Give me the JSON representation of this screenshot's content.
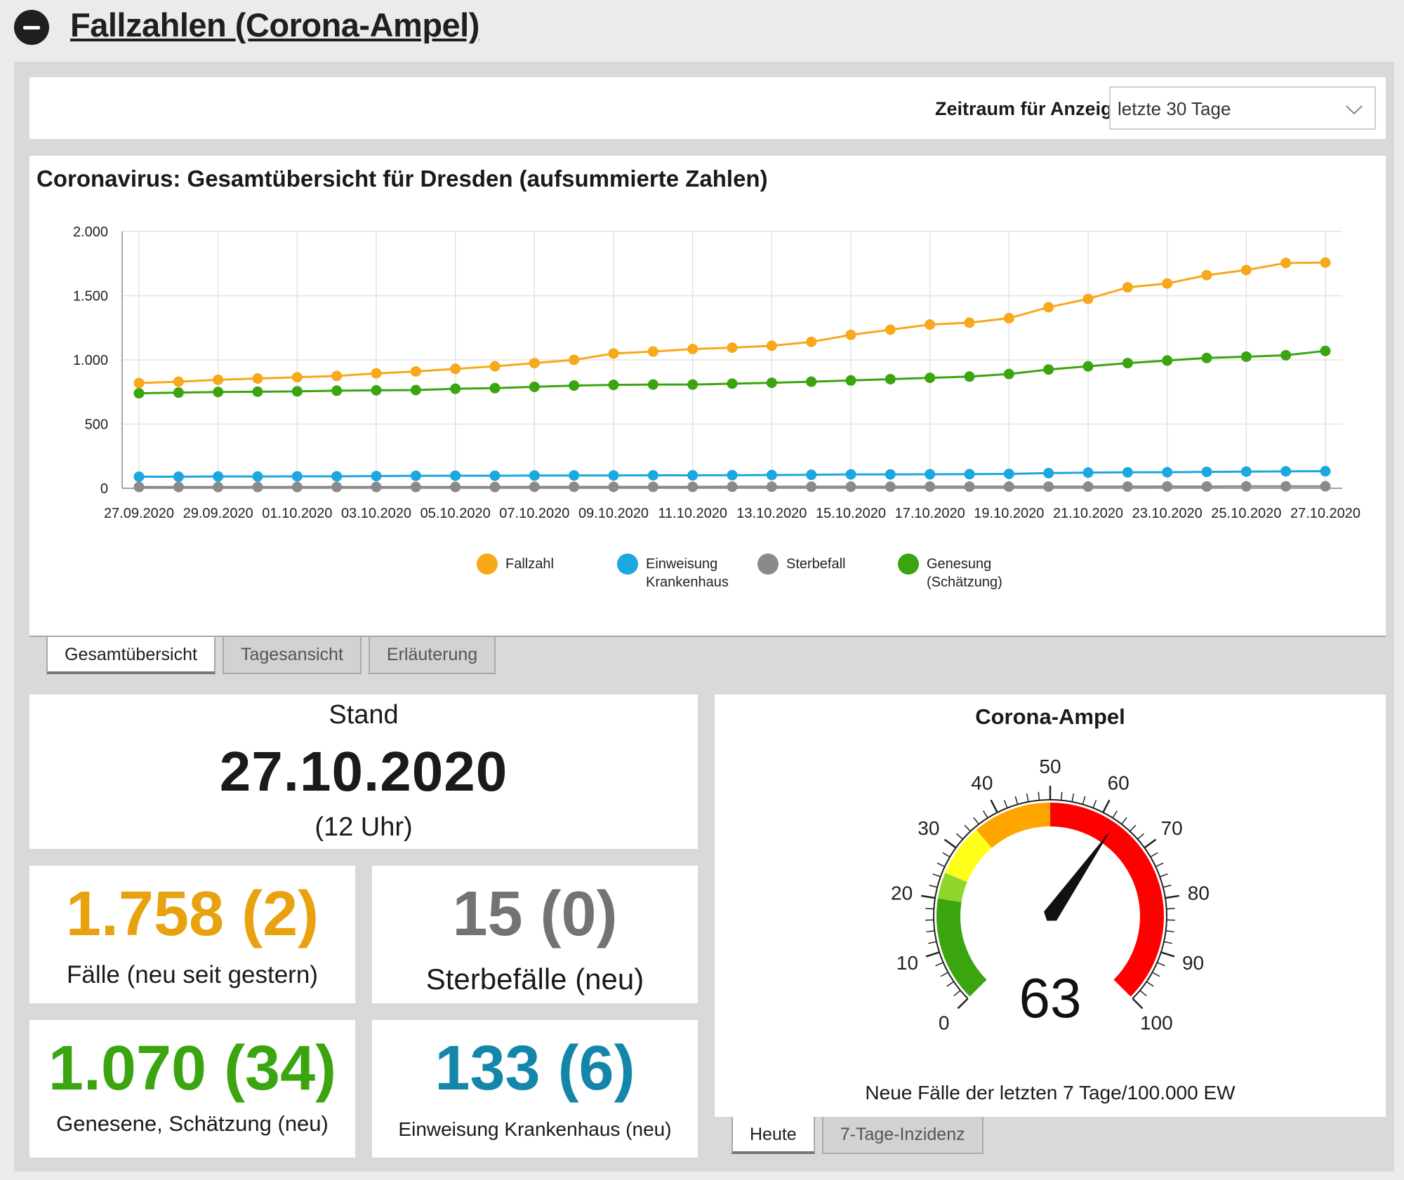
{
  "header": {
    "title": "Fallzahlen (Corona-Ampel)"
  },
  "filter": {
    "label": "Zeitraum für Anzeige:",
    "selected": "letzte 30 Tage"
  },
  "chart": {
    "title": "Coronavirus: Gesamtübersicht für Dresden (aufsummierte Zahlen)"
  },
  "chart_data": {
    "type": "line",
    "title": "Coronavirus: Gesamtübersicht für Dresden (aufsummierte Zahlen)",
    "xlabel": "",
    "ylabel": "",
    "ylim": [
      0,
      2000
    ],
    "yticks": [
      0,
      500,
      1000,
      1500,
      2000
    ],
    "ytick_labels": [
      "0",
      "500",
      "1.000",
      "1.500",
      "2.000"
    ],
    "x": [
      "27.09.2020",
      "28.09.2020",
      "29.09.2020",
      "30.09.2020",
      "01.10.2020",
      "02.10.2020",
      "03.10.2020",
      "04.10.2020",
      "05.10.2020",
      "06.10.2020",
      "07.10.2020",
      "08.10.2020",
      "09.10.2020",
      "10.10.2020",
      "11.10.2020",
      "12.10.2020",
      "13.10.2020",
      "14.10.2020",
      "15.10.2020",
      "16.10.2020",
      "17.10.2020",
      "18.10.2020",
      "19.10.2020",
      "20.10.2020",
      "21.10.2020",
      "22.10.2020",
      "23.10.2020",
      "24.10.2020",
      "25.10.2020",
      "26.10.2020",
      "27.10.2020"
    ],
    "xtick_labels": [
      "27.09.2020",
      "29.09.2020",
      "01.10.2020",
      "03.10.2020",
      "05.10.2020",
      "07.10.2020",
      "09.10.2020",
      "11.10.2020",
      "13.10.2020",
      "15.10.2020",
      "17.10.2020",
      "19.10.2020",
      "21.10.2020",
      "23.10.2020",
      "25.10.2020",
      "27.10.2020"
    ],
    "grid": true,
    "legend_position": "bottom",
    "series": [
      {
        "name": "Fallzahl",
        "color": "#f7a81b",
        "values": [
          820,
          830,
          845,
          855,
          865,
          875,
          895,
          910,
          930,
          950,
          975,
          1000,
          1050,
          1065,
          1085,
          1095,
          1110,
          1140,
          1195,
          1235,
          1275,
          1290,
          1325,
          1410,
          1475,
          1565,
          1595,
          1660,
          1700,
          1755,
          1758
        ]
      },
      {
        "name": "Einweisung Krankenhaus",
        "color": "#1ba7e0",
        "values": [
          90,
          90,
          92,
          92,
          93,
          93,
          95,
          97,
          98,
          98,
          99,
          100,
          100,
          101,
          101,
          102,
          103,
          105,
          108,
          108,
          109,
          110,
          112,
          118,
          122,
          124,
          125,
          128,
          130,
          132,
          133
        ]
      },
      {
        "name": "Sterbefall",
        "color": "#8a8a8a",
        "values": [
          10,
          10,
          10,
          10,
          10,
          10,
          10,
          10,
          10,
          10,
          11,
          11,
          11,
          11,
          11,
          12,
          12,
          12,
          12,
          12,
          13,
          13,
          13,
          13,
          13,
          13,
          14,
          14,
          15,
          15,
          15
        ]
      },
      {
        "name": "Genesung (Schätzung)",
        "color": "#3aa50f",
        "values": [
          740,
          745,
          750,
          752,
          755,
          760,
          763,
          765,
          775,
          780,
          790,
          800,
          805,
          808,
          808,
          815,
          822,
          830,
          840,
          850,
          860,
          870,
          890,
          925,
          950,
          975,
          995,
          1015,
          1025,
          1036,
          1070
        ]
      }
    ]
  },
  "legend": [
    {
      "line1": "Fallzahl",
      "line2": "",
      "color": "#f7a81b"
    },
    {
      "line1": "Einweisung",
      "line2": "Krankenhaus",
      "color": "#1ba7e0"
    },
    {
      "line1": "Sterbefall",
      "line2": "",
      "color": "#8a8a8a"
    },
    {
      "line1": "Genesung",
      "line2": "(Schätzung)",
      "color": "#3aa50f"
    }
  ],
  "chart_tabs": [
    "Gesamtübersicht",
    "Tagesansicht",
    "Erläuterung"
  ],
  "stand": {
    "label": "Stand",
    "date": "27.10.2020",
    "time": "(12 Uhr)"
  },
  "stats": {
    "cases": {
      "value": "1.758 (2)",
      "label": "Fälle (neu seit gestern)",
      "color": "#e8a20f"
    },
    "deaths": {
      "value": "15 (0)",
      "label": "Sterbefälle (neu)",
      "color": "#737373"
    },
    "recovered": {
      "value": "1.070 (34)",
      "label": "Genesene, Schätzung (neu)",
      "color": "#3aa50f"
    },
    "hospital": {
      "value": "133 (6)",
      "label": "Einweisung Krankenhaus (neu)",
      "color": "#1386a9"
    }
  },
  "gauge": {
    "title": "Corona-Ampel",
    "value": 63,
    "value_text": "63",
    "min": 0,
    "max": 100,
    "tick_labels": [
      "0",
      "10",
      "20",
      "30",
      "40",
      "50",
      "60",
      "70",
      "80",
      "90",
      "100"
    ],
    "bands": [
      {
        "from": 0,
        "to": 20,
        "color": "#3aa50f"
      },
      {
        "from": 20,
        "to": 25,
        "color": "#8fd62b"
      },
      {
        "from": 25,
        "to": 35,
        "color": "#ffff1a"
      },
      {
        "from": 35,
        "to": 50,
        "color": "#ffa500"
      },
      {
        "from": 50,
        "to": 100,
        "color": "#ff0000"
      }
    ],
    "caption": "Neue Fälle der letzten 7 Tage/100.000 EW"
  },
  "gauge_tabs": [
    "Heute",
    "7-Tage-Inzidenz"
  ]
}
